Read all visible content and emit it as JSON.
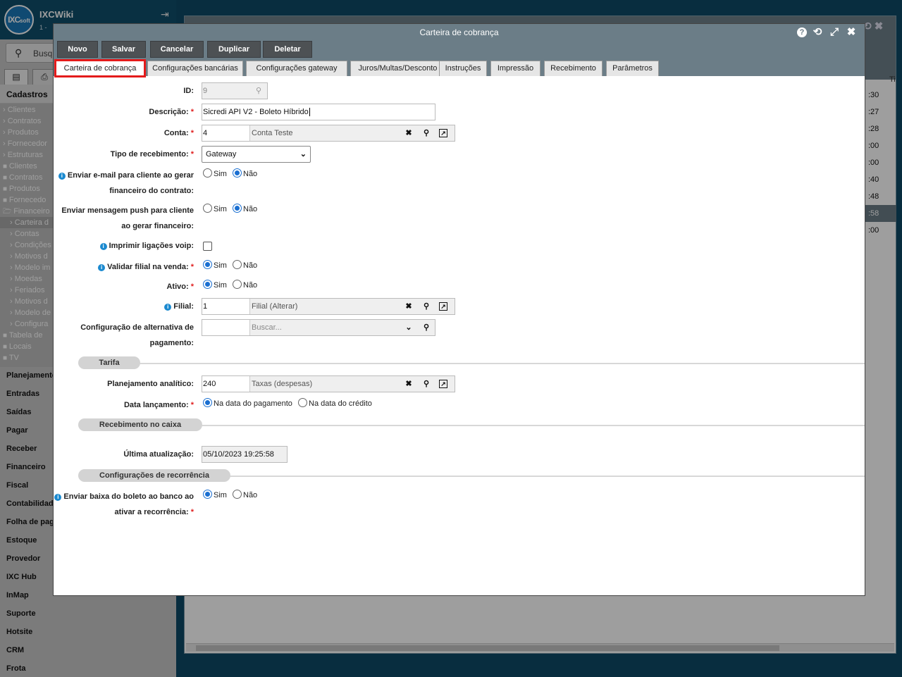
{
  "sidebar": {
    "app_name": "IXCWiki",
    "app_sub": "1 - ",
    "logo_text": "IXC",
    "logo_sub": "soft",
    "search_placeholder": "Busq",
    "section_title": "Cadastros",
    "tree": [
      {
        "label": "› Clientes",
        "indent": 0
      },
      {
        "label": "› Contratos",
        "indent": 0
      },
      {
        "label": "› Produtos",
        "indent": 0
      },
      {
        "label": "› Fornecedor",
        "indent": 0
      },
      {
        "label": "› Estruturas",
        "indent": 0
      },
      {
        "label": "Clientes",
        "indent": 1
      },
      {
        "label": "Contratos",
        "indent": 1
      },
      {
        "label": "Produtos",
        "indent": 1
      },
      {
        "label": "Fornecedo",
        "indent": 1
      },
      {
        "label": "Financeiro",
        "indent": 1
      },
      {
        "label": "› Carteira d",
        "indent": 2
      },
      {
        "label": "› Contas",
        "indent": 2
      },
      {
        "label": "› Condições",
        "indent": 2
      },
      {
        "label": "› Motivos d",
        "indent": 2
      },
      {
        "label": "› Modelo im",
        "indent": 2
      },
      {
        "label": "› Moedas",
        "indent": 2
      },
      {
        "label": "› Feriados",
        "indent": 2
      },
      {
        "label": "› Motivos d",
        "indent": 2
      },
      {
        "label": "› Modelo de",
        "indent": 2
      },
      {
        "label": "› Configura",
        "indent": 2
      },
      {
        "label": "Tabela de",
        "indent": 1
      },
      {
        "label": "Locais",
        "indent": 1
      },
      {
        "label": "TV",
        "indent": 1
      }
    ],
    "menu": [
      "Planejamento",
      "Entradas",
      "Saídas",
      "Pagar",
      "Receber",
      "Financeiro",
      "Fiscal",
      "Contabilidade",
      "Folha de pag",
      "Estoque",
      "Provedor",
      "IXC Hub",
      "InMap",
      "Suporte",
      "Hotsite",
      "CRM",
      "Frota"
    ]
  },
  "background": {
    "column_values": [
      ":30",
      ":27",
      ":28",
      ":00",
      ":00",
      ":40",
      ":48",
      ":58",
      ":00"
    ],
    "column_header": "Ti"
  },
  "modal": {
    "title": "Carteira de cobrança",
    "toolbar": [
      "Novo",
      "Salvar",
      "Cancelar",
      "Duplicar",
      "Deletar"
    ],
    "tabs": [
      "Carteira de cobrança",
      "Configurações bancárias",
      "Configurações gateway",
      "Juros/Multas/Desconto",
      "Instruções",
      "Impressão",
      "Recebimento",
      "Parâmetros"
    ],
    "active_tab": "Carteira de cobrança",
    "form": {
      "id_label": "ID:",
      "id_value": "9",
      "descricao_label": "Descrição:",
      "descricao_value": "Sicredi API V2 - Boleto Híbrido",
      "conta_label": "Conta:",
      "conta_code": "4",
      "conta_desc": "Conta Teste",
      "tipo_label": "Tipo de recebimento:",
      "tipo_value": "Gateway",
      "email_label_1": "Enviar e-mail para cliente ao gerar",
      "email_label_2": "financeiro do contrato:",
      "push_label_1": "Enviar mensagem push para cliente",
      "push_label_2": "ao gerar financeiro:",
      "voip_label": "Imprimir ligações voip:",
      "filial_venda_label": "Validar filial na venda:",
      "ativo_label": "Ativo:",
      "filial_label": "Filial:",
      "filial_code": "1",
      "filial_desc": "Filial (Alterar)",
      "alt_pag_label_1": "Configuração de alternativa de",
      "alt_pag_label_2": "pagamento:",
      "alt_pag_placeholder": "Buscar...",
      "sim": "Sim",
      "nao": "Não",
      "section_tarifa": "Tarifa",
      "plan_label": "Planejamento analítico:",
      "plan_code": "240",
      "plan_desc": "Taxas (despesas)",
      "data_lanc_label": "Data lançamento:",
      "data_pag": "Na data do pagamento",
      "data_cred": "Na data do crédito",
      "section_caixa": "Recebimento no caixa",
      "ultima_label": "Última atualização:",
      "ultima_value": "05/10/2023 19:25:58",
      "section_recorrencia": "Configurações de recorrência",
      "baixa_label_1": "Enviar baixa do boleto ao banco ao",
      "baixa_label_2": "ativar a recorrência:"
    }
  }
}
